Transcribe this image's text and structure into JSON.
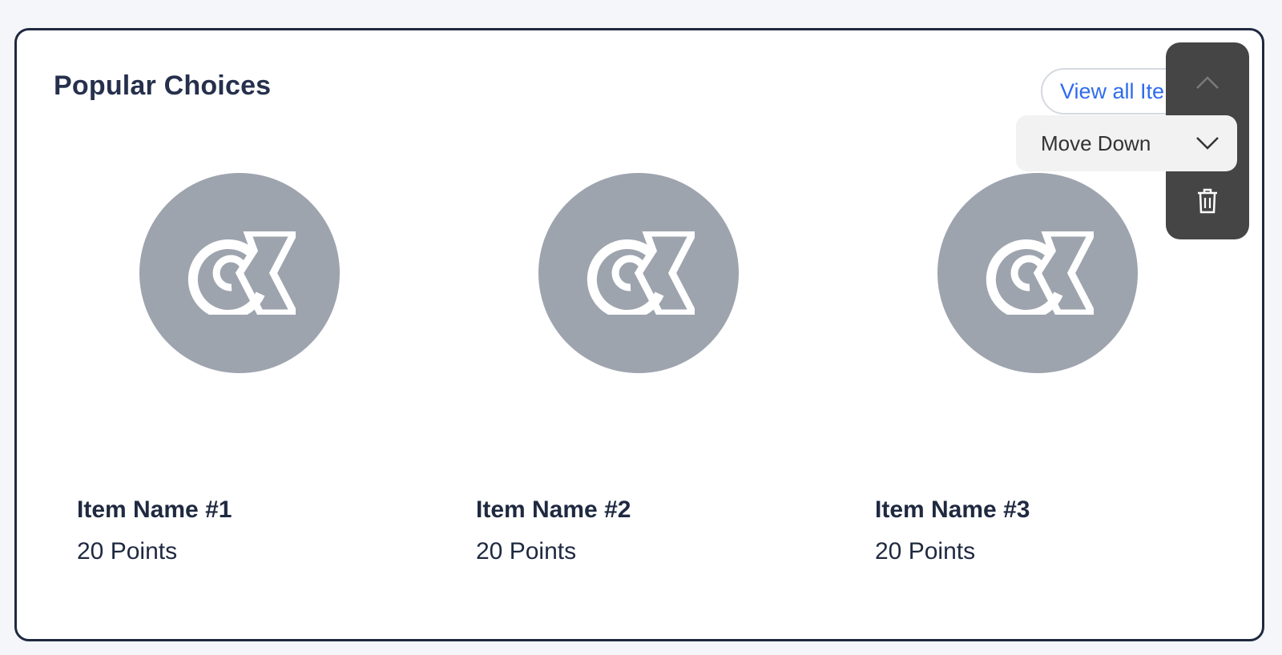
{
  "section": {
    "title": "Popular Choices",
    "view_all_label": "View all Items"
  },
  "items": [
    {
      "name": "Item Name #1",
      "points": "20 Points",
      "icon": "brand-logo-icon"
    },
    {
      "name": "Item Name #2",
      "points": "20 Points",
      "icon": "brand-logo-icon"
    },
    {
      "name": "Item Name #3",
      "points": "20 Points",
      "icon": "brand-logo-icon"
    }
  ],
  "toolbar": {
    "move_up_icon": "chevron-up-icon",
    "move_down_label": "Move Down",
    "move_down_icon": "chevron-down-icon",
    "delete_icon": "trash-icon"
  },
  "colors": {
    "card_border": "#1f2940",
    "link": "#2f6bf0",
    "thumb": "#9ea4ae",
    "toolbar_bg": "#454545",
    "tooltip_bg": "#f2f2f2"
  }
}
